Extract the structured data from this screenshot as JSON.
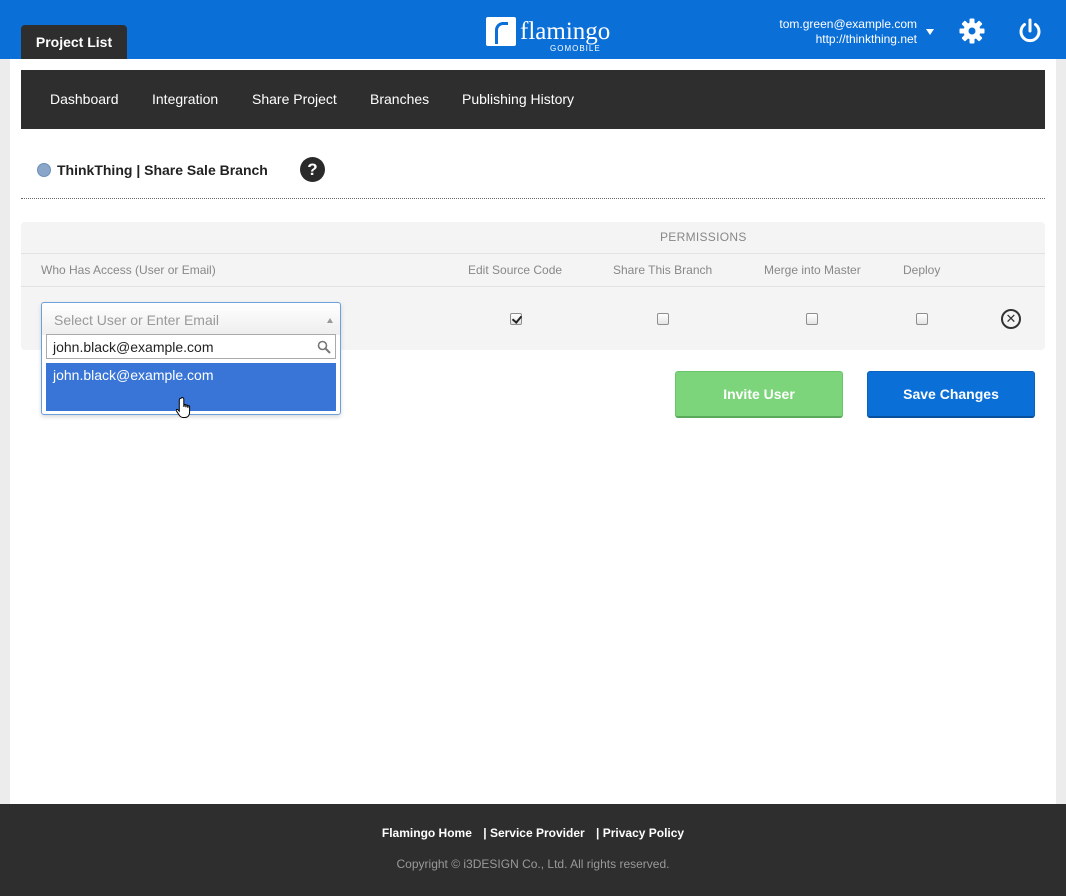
{
  "header": {
    "project_tab": "Project List",
    "logo_text": "flamingo",
    "logo_sub": "GOMOBILE",
    "user_email": "tom.green@example.com",
    "user_site": "http://thinkthing.net"
  },
  "nav": {
    "items": [
      "Dashboard",
      "Integration",
      "Share Project",
      "Branches",
      "Publishing History"
    ]
  },
  "breadcrumb": "ThinkThing | Share Sale Branch",
  "help_label": "?",
  "permissions": {
    "title": "PERMISSIONS",
    "who_header": "Who Has Access (User or Email)",
    "columns": [
      "Edit Source Code",
      "Share This Branch",
      "Merge into Master",
      "Deploy"
    ],
    "row": {
      "edit_source_code": true,
      "share_this_branch": false,
      "merge_into_master": false,
      "deploy": false
    }
  },
  "select": {
    "placeholder": "Select User or Enter Email",
    "search_value": "john.black@example.com",
    "results": [
      "john.black@example.com"
    ]
  },
  "buttons": {
    "invite": "Invite User",
    "save": "Save Changes"
  },
  "footer": {
    "links": [
      "Flamingo Home",
      "| Service Provider",
      "| Privacy Policy"
    ],
    "copyright": "Copyright © i3DESIGN Co., Ltd. All rights reserved."
  },
  "colors": {
    "brand_blue": "#0b6fd8",
    "dark_bar": "#2e2e2e",
    "invite_green": "#7dd57b",
    "selected_blue": "#3875d7"
  }
}
